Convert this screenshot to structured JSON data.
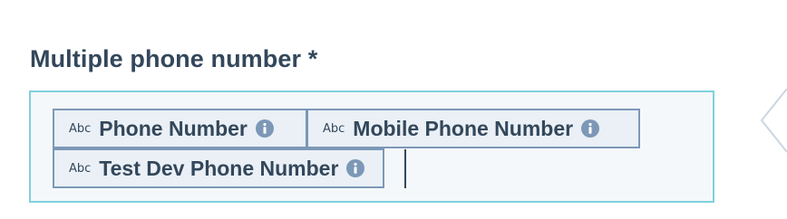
{
  "field": {
    "label": "Multiple phone number *"
  },
  "chips": [
    {
      "type": "Abc",
      "label": "Phone Number",
      "icon": "info-icon"
    },
    {
      "type": "Abc",
      "label": "Mobile Phone Number",
      "icon": "info-icon"
    },
    {
      "type": "Abc",
      "label": "Test Dev Phone Number",
      "icon": "info-icon"
    }
  ],
  "colors": {
    "label_text": "#33475b",
    "field_border": "#7fd1de",
    "field_bg": "#f5f8fa",
    "chip_bg": "#eaf0f6",
    "chip_border": "#7c98b6",
    "icon_fill": "#7c98b6"
  }
}
